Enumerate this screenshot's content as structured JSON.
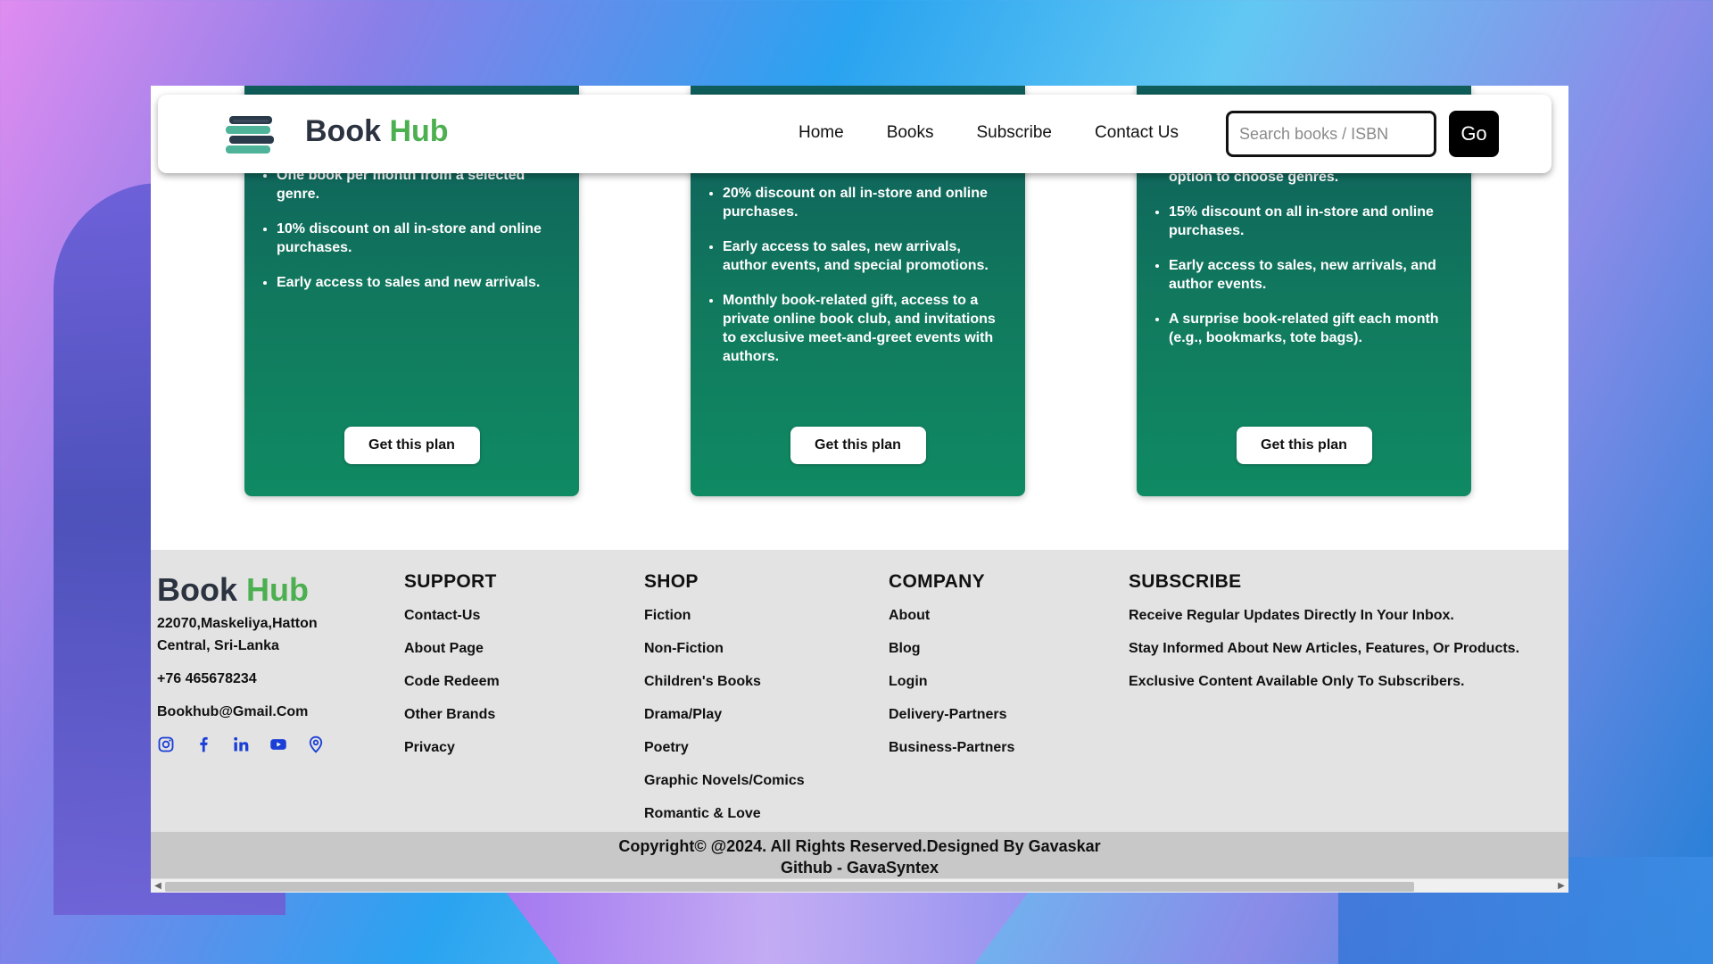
{
  "brand": {
    "name_part1": "Book",
    "name_part2": "Hub"
  },
  "nav": {
    "links": [
      "Home",
      "Books",
      "Subscribe",
      "Contact Us"
    ],
    "search_placeholder": "Search books / ISBN",
    "go_label": "Go"
  },
  "plans": [
    {
      "features": [
        "One book per month from a selected genre.",
        "10% discount on all in-store and online purchases.",
        "Early access to sales and new arrivals."
      ],
      "button": "Get this plan"
    },
    {
      "features": [
        "20% discount on all in-store and online purchases.",
        "Early access to sales, new arrivals, author events, and special promotions.",
        "Monthly book-related gift, access to a private online book club, and invitations to exclusive meet-and-greet events with authors."
      ],
      "button": "Get this plan"
    },
    {
      "features": [
        "option to choose genres.",
        "15% discount on all in-store and online purchases.",
        "Early access to sales, new arrivals, and author events.",
        "A surprise book-related gift each month (e.g., bookmarks, tote bags)."
      ],
      "button": "Get this plan"
    }
  ],
  "footer": {
    "brand_part1": "Book",
    "brand_part2": "Hub",
    "address_line1": "22070,Maskeliya,Hatton",
    "address_line2": "Central, Sri-Lanka",
    "phone": "+76 465678234",
    "email": "Bookhub@Gmail.Com",
    "socials": [
      "instagram-icon",
      "facebook-icon",
      "linkedin-icon",
      "youtube-icon",
      "location-icon"
    ],
    "support": {
      "title": "SUPPORT",
      "items": [
        "Contact-Us",
        "About Page",
        "Code Redeem",
        "Other Brands",
        "Privacy"
      ]
    },
    "shop": {
      "title": "SHOP",
      "items": [
        "Fiction",
        "Non-Fiction",
        "Children's Books",
        "Drama/Play",
        "Poetry",
        "Graphic Novels/Comics",
        "Romantic & Love"
      ]
    },
    "company": {
      "title": "COMPANY",
      "items": [
        "About",
        "Blog",
        "Login",
        "Delivery-Partners",
        "Business-Partners"
      ]
    },
    "subscribe": {
      "title": "SUBSCRIBE",
      "items": [
        "Receive Regular Updates Directly In Your Inbox.",
        "Stay Informed About New Articles, Features, Or Products.",
        "Exclusive Content Available Only To Subscribers."
      ]
    },
    "copyright_line1": "Copyright© @2024. All Rights Reserved.Designed By Gavaskar",
    "copyright_line2": "Github - GavaSyntex"
  },
  "colors": {
    "card_green": "#117a5e",
    "brand_green": "#4caf50",
    "social_blue": "#1a3fd6"
  }
}
